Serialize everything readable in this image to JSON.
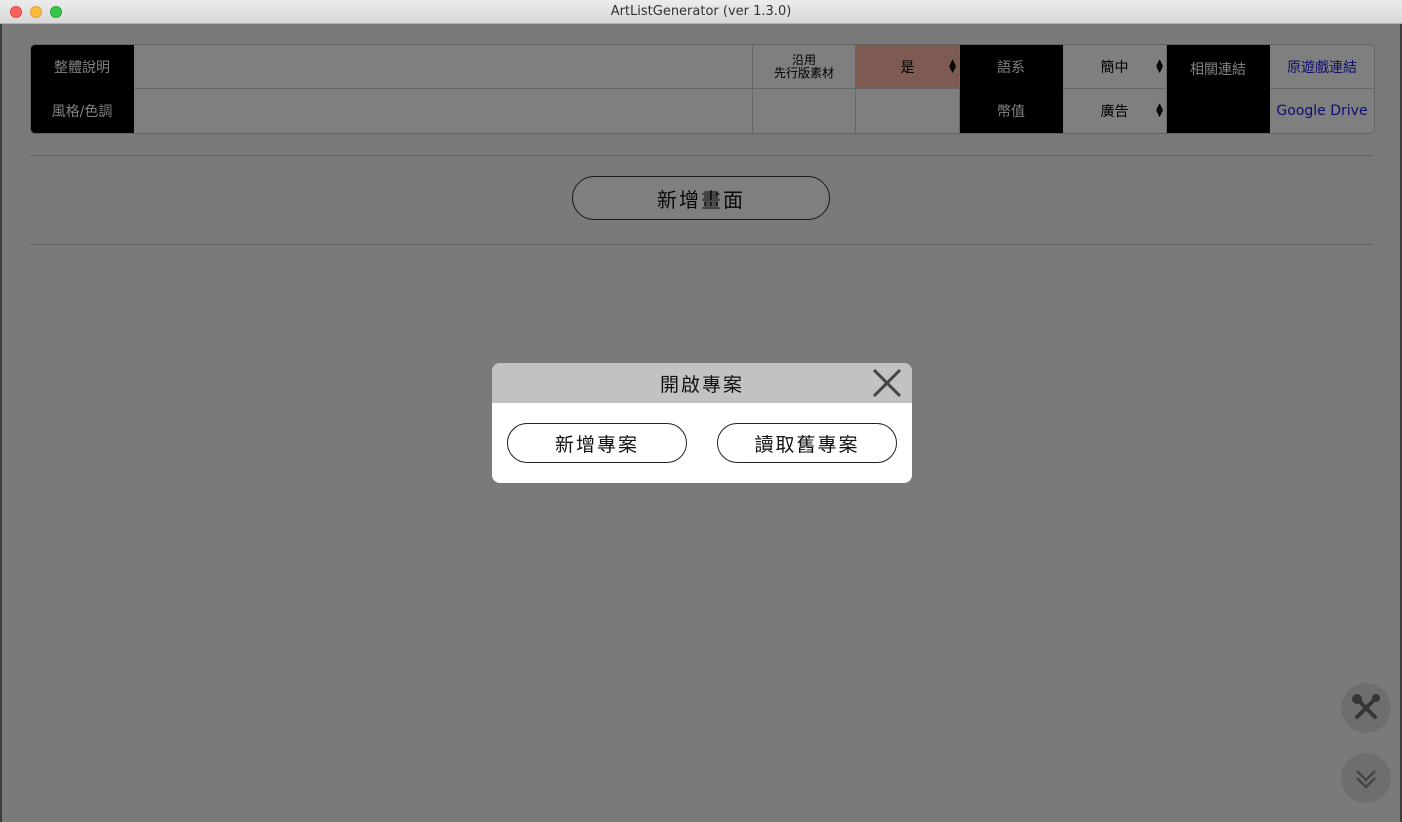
{
  "window": {
    "title": "ArtListGenerator (ver 1.3.0)"
  },
  "header_grid": {
    "overall_description_label": "整體說明",
    "style_color_label": "風格/色調",
    "reuse_label_line1": "沿用",
    "reuse_label_line2": "先行版素材",
    "reuse_value": "是",
    "language_label": "語系",
    "language_value": "簡中",
    "currency_label": "幣值",
    "currency_value": "廣告",
    "related_links_label": "相關連結",
    "original_game_link": "原遊戲連結",
    "google_drive_link": "Google Drive"
  },
  "main": {
    "add_scene_button": "新增畫面"
  },
  "modal": {
    "title": "開啟專案",
    "new_project_button": "新增專案",
    "load_project_button": "讀取舊專案"
  },
  "icons": {
    "settings": "tools-icon",
    "scroll_down": "double-chevron-down-icon",
    "close": "close-icon"
  },
  "colors": {
    "pink_select": "#fab7a7",
    "link": "#1c1ce0",
    "overlay": "rgba(0,0,0,0.5)"
  }
}
